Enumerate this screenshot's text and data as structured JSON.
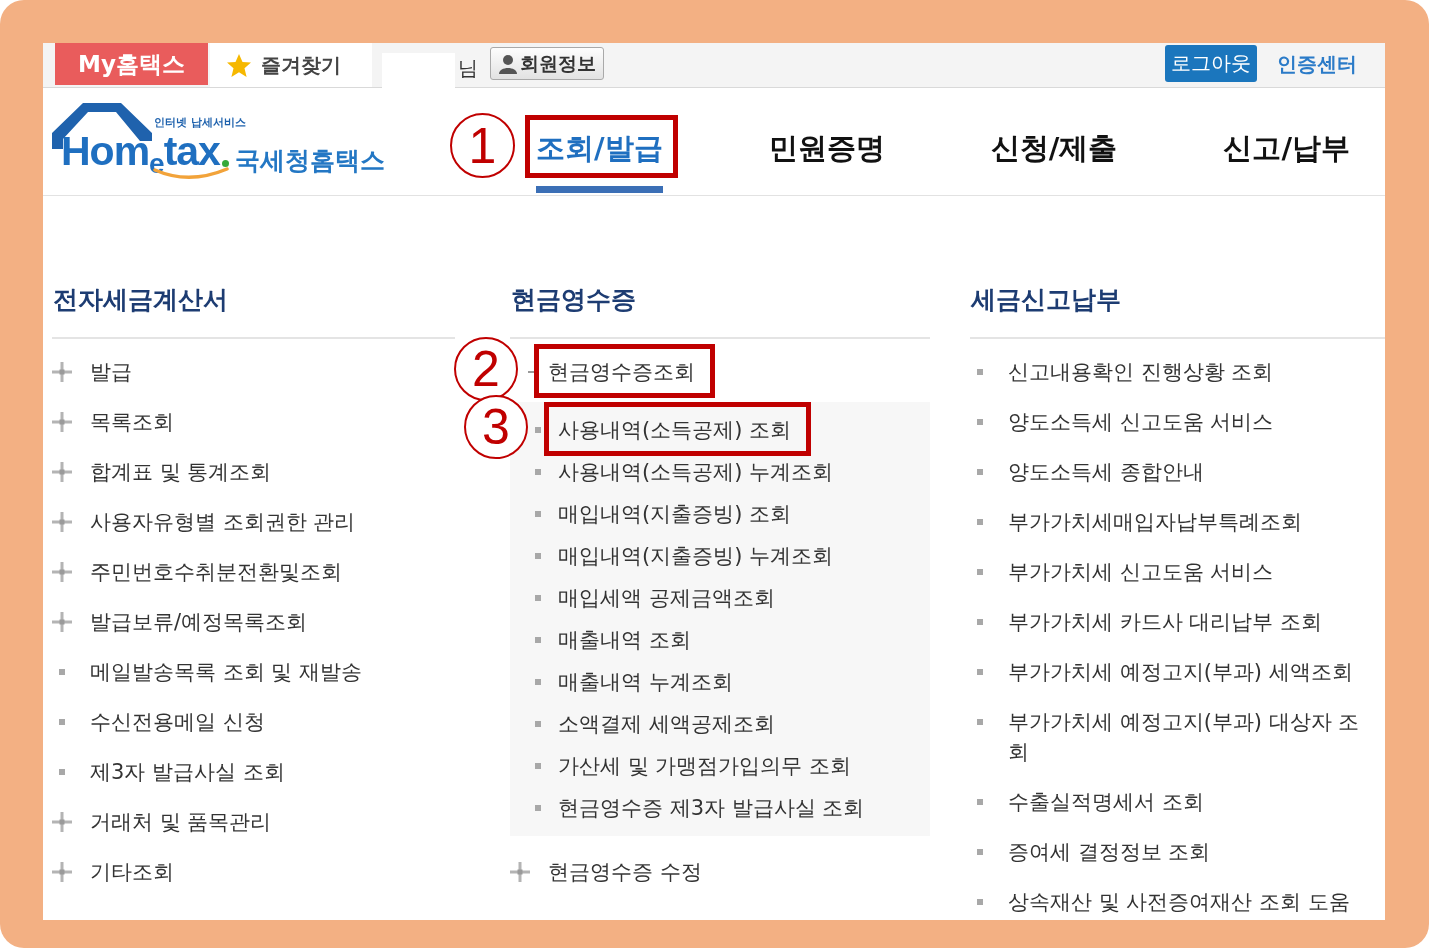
{
  "top_bar": {
    "tabs": [
      {
        "label": "My홈택스",
        "kind": "brand"
      },
      {
        "label": "즐겨찾기",
        "kind": "favorites"
      }
    ],
    "user_suffix": "님",
    "member_button": "회원정보",
    "logout_button": "로그아웃",
    "cert_link": "인증센터"
  },
  "logo": {
    "tagline": "인터넷 납세서비스",
    "wordmark": "Hom$_{e}$tax",
    "name": "국세청홈택스"
  },
  "nav": [
    {
      "label": "조회/발급",
      "selected": true,
      "callout": "1"
    },
    {
      "label": "민원증명",
      "selected": false
    },
    {
      "label": "신청/제출",
      "selected": false
    },
    {
      "label": "신고/납부",
      "selected": false
    }
  ],
  "columns": [
    {
      "heading": "전자세금계산서",
      "items": [
        {
          "label": "발급",
          "kind": "group",
          "expanded": false
        },
        {
          "label": "목록조회",
          "kind": "group",
          "expanded": false
        },
        {
          "label": "합계표 및 통계조회",
          "kind": "group",
          "expanded": false
        },
        {
          "label": "사용자유형별 조회권한 관리",
          "kind": "group",
          "expanded": false
        },
        {
          "label": "주민번호수취분전환및조회",
          "kind": "group",
          "expanded": false
        },
        {
          "label": "발급보류/예정목록조회",
          "kind": "group",
          "expanded": false
        },
        {
          "label": "메일발송목록 조회 및 재발송",
          "kind": "link"
        },
        {
          "label": "수신전용메일 신청",
          "kind": "link"
        },
        {
          "label": "제3자 발급사실 조회",
          "kind": "link"
        },
        {
          "label": "거래처 및 품목관리",
          "kind": "group",
          "expanded": false
        },
        {
          "label": "기타조회",
          "kind": "group",
          "expanded": false
        }
      ]
    },
    {
      "heading": "현금영수증",
      "items": [
        {
          "label": "현금영수증조회",
          "kind": "group",
          "expanded": true,
          "callout": "2",
          "children": [
            {
              "label": "사용내역(소득공제) 조회",
              "kind": "link",
              "callout": "3"
            },
            {
              "label": "사용내역(소득공제) 누계조회",
              "kind": "link"
            },
            {
              "label": "매입내역(지출증빙) 조회",
              "kind": "link"
            },
            {
              "label": "매입내역(지출증빙) 누계조회",
              "kind": "link"
            },
            {
              "label": "매입세액 공제금액조회",
              "kind": "link"
            },
            {
              "label": "매출내역 조회",
              "kind": "link"
            },
            {
              "label": "매출내역 누계조회",
              "kind": "link"
            },
            {
              "label": "소액결제 세액공제조회",
              "kind": "link"
            },
            {
              "label": "가산세 및 가맹점가입의무 조회",
              "kind": "link"
            },
            {
              "label": "현금영수증 제3자 발급사실 조회",
              "kind": "link"
            }
          ]
        },
        {
          "label": "현금영수증 수정",
          "kind": "group",
          "expanded": false
        }
      ]
    },
    {
      "heading": "세금신고납부",
      "items": [
        {
          "label": "신고내용확인 진행상황 조회",
          "kind": "link"
        },
        {
          "label": "양도소득세 신고도움 서비스",
          "kind": "link"
        },
        {
          "label": "양도소득세 종합안내",
          "kind": "link"
        },
        {
          "label": "부가가치세매입자납부특례조회",
          "kind": "link"
        },
        {
          "label": "부가가치세 신고도움 서비스",
          "kind": "link"
        },
        {
          "label": "부가가치세 카드사 대리납부 조회",
          "kind": "link"
        },
        {
          "label": "부가가치세 예정고지(부과) 세액조회",
          "kind": "link"
        },
        {
          "label": "부가가치세 예정고지(부과) 대상자 조회",
          "kind": "link"
        },
        {
          "label": "수출실적명세서 조회",
          "kind": "link"
        },
        {
          "label": "증여세 결정정보 조회",
          "kind": "link"
        },
        {
          "label": "상속재산 및 사전증여재산 조회 도움",
          "kind": "link"
        }
      ]
    }
  ]
}
